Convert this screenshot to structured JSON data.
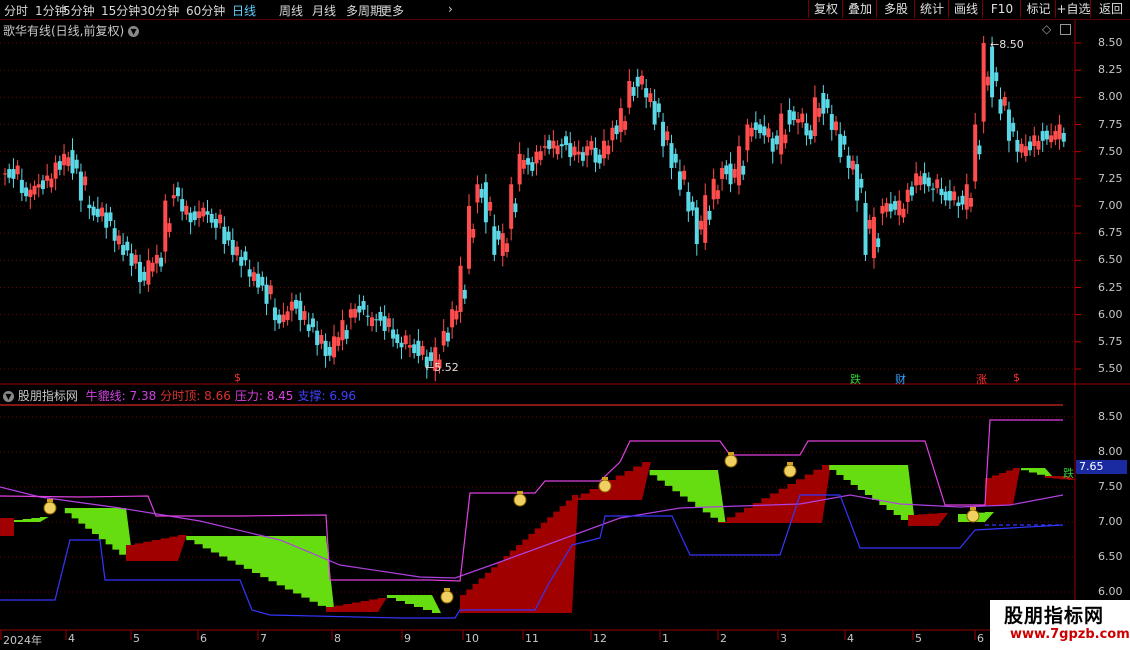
{
  "toolbar": {
    "periods": [
      "分时",
      "1分钟",
      "5分钟",
      "15分钟",
      "30分钟",
      "60分钟",
      "日线",
      "周线",
      "月线",
      "多周期",
      "更多"
    ],
    "active": "日线",
    "more_chevron": "›",
    "buttons": [
      "复权",
      "叠加",
      "多股",
      "统计",
      "画线",
      "F10",
      "标记",
      "+自选",
      "返回"
    ]
  },
  "main_panel": {
    "title": "歌华有线(日线,前复权)",
    "high_marker": "8.50",
    "low_marker": "5.52",
    "y_ticks": [
      "8.50",
      "8.25",
      "8.00",
      "7.75",
      "7.50",
      "7.25",
      "7.00",
      "6.75",
      "6.50",
      "6.25",
      "6.00",
      "5.75",
      "5.50"
    ],
    "event_marks": [
      {
        "text": "$",
        "color": "#ff3030"
      },
      {
        "text": "跌",
        "color": "#30d030"
      },
      {
        "text": "财",
        "color": "#3aa0ff"
      },
      {
        "text": "涨",
        "color": "#ff3030"
      },
      {
        "text": "$",
        "color": "#ff3030"
      }
    ],
    "candles": [
      [
        0,
        7.3
      ],
      [
        1,
        7.25
      ],
      [
        2,
        7.12
      ],
      [
        3,
        7.15
      ],
      [
        4,
        7.2
      ],
      [
        5,
        7.28
      ],
      [
        6,
        7.4
      ],
      [
        7,
        7.48
      ],
      [
        8,
        7.3
      ],
      [
        9,
        7.05
      ],
      [
        10,
        6.98
      ],
      [
        11,
        6.9
      ],
      [
        12,
        6.8
      ],
      [
        13,
        6.68
      ],
      [
        14,
        6.55
      ],
      [
        15,
        6.45
      ],
      [
        16,
        6.3
      ],
      [
        17,
        6.5
      ],
      [
        18,
        6.55
      ],
      [
        19,
        7.05
      ],
      [
        20,
        7.1
      ],
      [
        21,
        6.95
      ],
      [
        22,
        6.85
      ],
      [
        23,
        6.95
      ],
      [
        24,
        6.92
      ],
      [
        25,
        6.8
      ],
      [
        26,
        6.65
      ],
      [
        27,
        6.55
      ],
      [
        28,
        6.45
      ],
      [
        29,
        6.35
      ],
      [
        30,
        6.25
      ],
      [
        31,
        6.1
      ],
      [
        32,
        5.95
      ],
      [
        33,
        6.0
      ],
      [
        34,
        6.12
      ],
      [
        35,
        5.95
      ],
      [
        36,
        5.85
      ],
      [
        37,
        5.72
      ],
      [
        38,
        5.62
      ],
      [
        39,
        5.8
      ],
      [
        40,
        5.95
      ],
      [
        41,
        6.05
      ],
      [
        42,
        6.02
      ],
      [
        43,
        5.98
      ],
      [
        44,
        5.95
      ],
      [
        45,
        5.85
      ],
      [
        46,
        5.78
      ],
      [
        47,
        5.7
      ],
      [
        48,
        5.72
      ],
      [
        49,
        5.62
      ],
      [
        50,
        5.52
      ],
      [
        51,
        5.7
      ],
      [
        52,
        5.85
      ],
      [
        53,
        6.05
      ],
      [
        54,
        6.45
      ],
      [
        55,
        7.0
      ],
      [
        56,
        7.2
      ],
      [
        57,
        6.85
      ],
      [
        58,
        6.55
      ],
      [
        59,
        6.75
      ],
      [
        60,
        7.2
      ],
      [
        61,
        7.48
      ],
      [
        62,
        7.38
      ],
      [
        63,
        7.5
      ],
      [
        64,
        7.55
      ],
      [
        65,
        7.6
      ],
      [
        66,
        7.55
      ],
      [
        67,
        7.45
      ],
      [
        68,
        7.5
      ],
      [
        69,
        7.55
      ],
      [
        70,
        7.4
      ],
      [
        71,
        7.6
      ],
      [
        72,
        7.72
      ],
      [
        73,
        7.9
      ],
      [
        74,
        8.15
      ],
      [
        75,
        8.1
      ],
      [
        76,
        8.0
      ],
      [
        77,
        7.75
      ],
      [
        78,
        7.55
      ],
      [
        79,
        7.35
      ],
      [
        80,
        7.15
      ],
      [
        81,
        6.95
      ],
      [
        82,
        6.65
      ],
      [
        83,
        7.1
      ],
      [
        84,
        7.25
      ],
      [
        85,
        7.35
      ],
      [
        86,
        7.2
      ],
      [
        87,
        7.55
      ],
      [
        88,
        7.75
      ],
      [
        89,
        7.7
      ],
      [
        90,
        7.65
      ],
      [
        91,
        7.5
      ],
      [
        92,
        7.85
      ],
      [
        93,
        7.75
      ],
      [
        94,
        7.8
      ],
      [
        95,
        7.65
      ],
      [
        96,
        8.0
      ],
      [
        97,
        7.85
      ],
      [
        98,
        7.7
      ],
      [
        99,
        7.45
      ],
      [
        100,
        7.35
      ],
      [
        101,
        7.05
      ],
      [
        102,
        6.55
      ],
      [
        103,
        6.9
      ],
      [
        104,
        7.0
      ],
      [
        105,
        6.95
      ],
      [
        106,
        7.05
      ],
      [
        107,
        7.15
      ],
      [
        108,
        7.3
      ],
      [
        109,
        7.2
      ],
      [
        110,
        7.15
      ],
      [
        111,
        7.1
      ],
      [
        112,
        7.05
      ],
      [
        113,
        7.0
      ],
      [
        114,
        7.2
      ],
      [
        115,
        7.75
      ],
      [
        116,
        8.5
      ],
      [
        117,
        8.0
      ],
      [
        118,
        7.85
      ],
      [
        119,
        7.6
      ],
      [
        120,
        7.5
      ],
      [
        121,
        7.55
      ],
      [
        122,
        7.65
      ],
      [
        123,
        7.6
      ],
      [
        124,
        7.65
      ],
      [
        125,
        7.75
      ]
    ]
  },
  "sub_panel": {
    "title": "股朋指标网",
    "legend": [
      {
        "label": "牛貔线:",
        "value": "7.38",
        "color": "#d040e0"
      },
      {
        "label": "分时顶:",
        "value": "8.66",
        "color": "#e03030"
      },
      {
        "label": "压力:",
        "value": "8.45",
        "color": "#e040e0"
      },
      {
        "label": "支撑:",
        "value": "6.96",
        "color": "#4040ff"
      }
    ],
    "y_ticks": [
      "8.50",
      "8.00",
      "7.50",
      "7.00",
      "6.50",
      "6.00"
    ],
    "current_value": "7.65",
    "current_tag": "跌"
  },
  "x_axis": [
    "2024年",
    "4",
    "5",
    "6",
    "7",
    "8",
    "9",
    "10",
    "11",
    "12",
    "1",
    "2",
    "3",
    "4",
    "5",
    "6"
  ],
  "watermark": {
    "title": "股朋指标网",
    "url": "www.7gpzb.com"
  }
}
